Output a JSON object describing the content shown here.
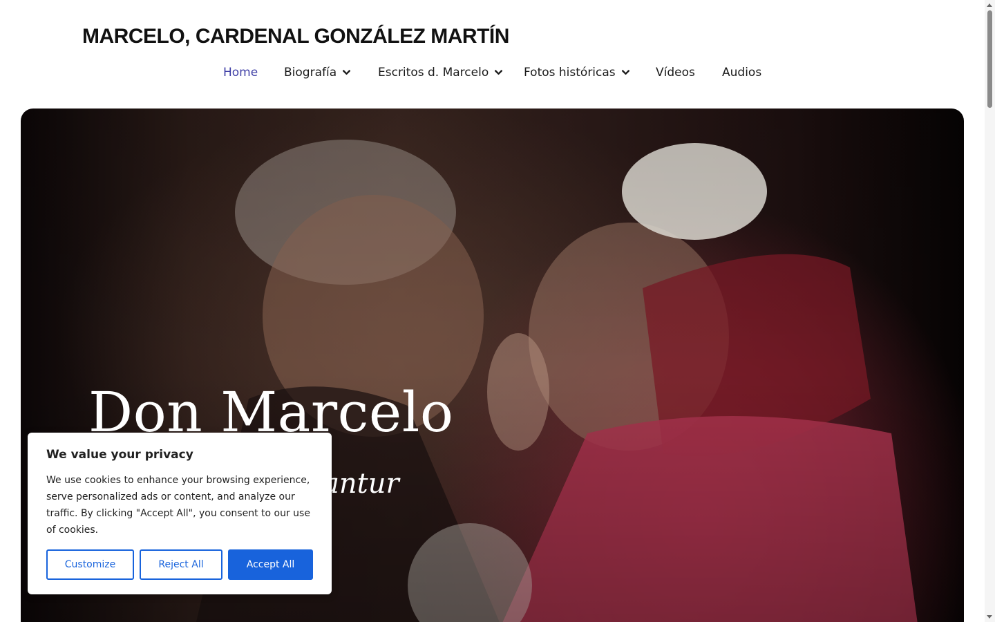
{
  "site": {
    "title": "MARCELO, CARDENAL GONZÁLEZ MARTÍN"
  },
  "nav": {
    "items": [
      {
        "label": "Home",
        "active": true,
        "has_dropdown": false
      },
      {
        "label": "Biografía",
        "active": false,
        "has_dropdown": true
      },
      {
        "label": "Escritos d. Marcelo",
        "active": false,
        "has_dropdown": true
      },
      {
        "label": "Fotos históricas",
        "active": false,
        "has_dropdown": true
      },
      {
        "label": "Vídeos",
        "active": false,
        "has_dropdown": false
      },
      {
        "label": "Audios",
        "active": false,
        "has_dropdown": false
      }
    ],
    "dropdown_icon": "chevron-down-icon",
    "active_color": "#3f3fa6"
  },
  "hero": {
    "title": "Don Marcelo",
    "motto": "zantur"
  },
  "cookie_banner": {
    "title": "We value your privacy",
    "text": "We use cookies to enhance your browsing experience, serve personalized ads or content, and analyze our traffic. By clicking \"Accept All\", you consent to our use of cookies.",
    "buttons": {
      "customize": "Customize",
      "reject": "Reject All",
      "accept": "Accept All"
    },
    "accent_color": "#1863dc"
  }
}
